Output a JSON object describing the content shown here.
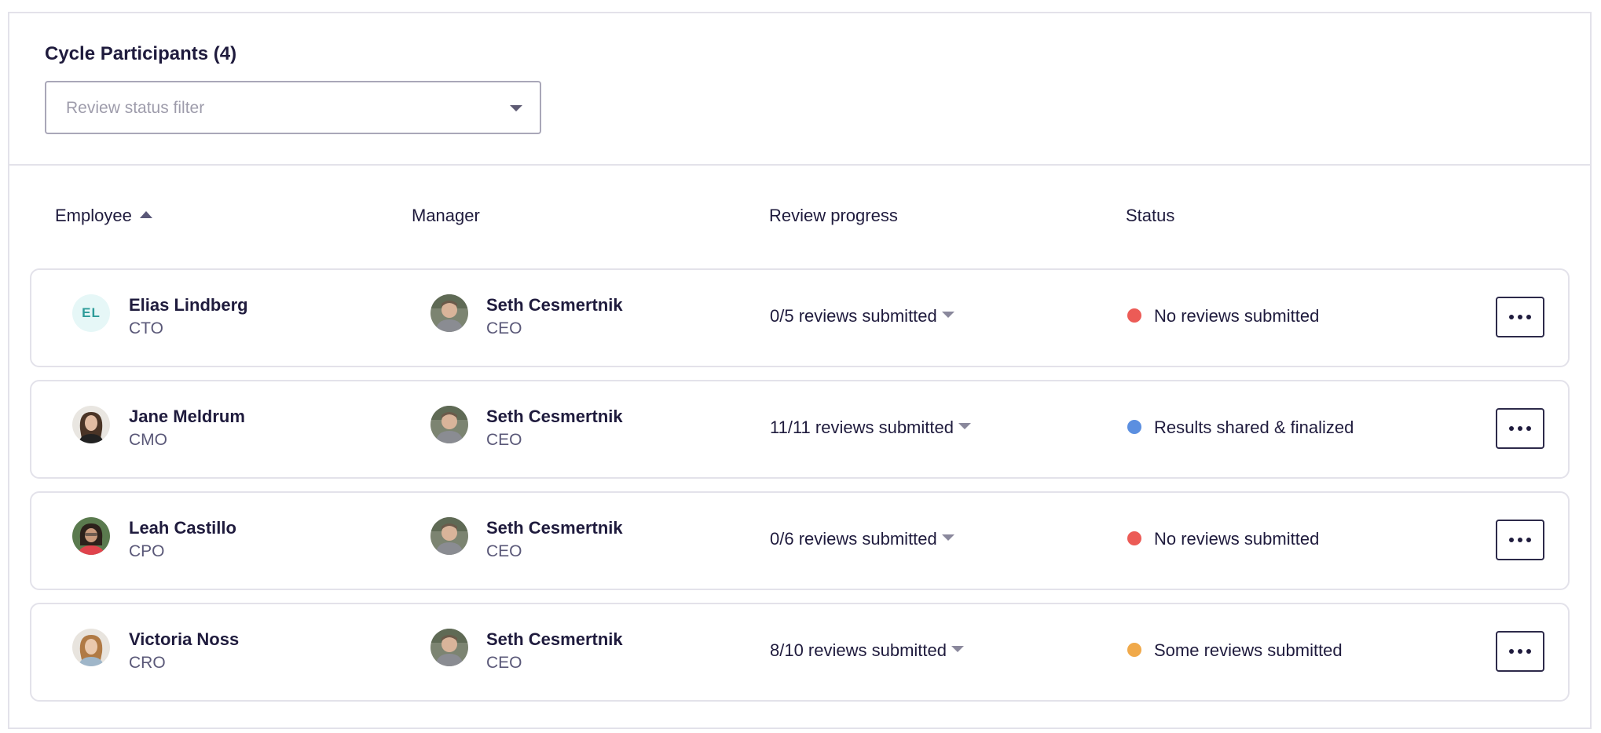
{
  "header": {
    "title": "Cycle Participants (4)",
    "filter_placeholder": "Review status filter"
  },
  "columns": {
    "employee": "Employee",
    "manager": "Manager",
    "progress": "Review progress",
    "status": "Status"
  },
  "rows": [
    {
      "employee_name": "Elias Lindberg",
      "employee_role": "CTO",
      "employee_initials": "EL",
      "manager_name": "Seth Cesmertnik",
      "manager_role": "CEO",
      "progress": "0/5 reviews submitted",
      "status": "No reviews submitted",
      "status_color": "#ec5b56"
    },
    {
      "employee_name": "Jane Meldrum",
      "employee_role": "CMO",
      "manager_name": "Seth Cesmertnik",
      "manager_role": "CEO",
      "progress": "11/11 reviews submitted",
      "status": "Results shared & finalized",
      "status_color": "#5b8fe0"
    },
    {
      "employee_name": "Leah Castillo",
      "employee_role": "CPO",
      "manager_name": "Seth Cesmertnik",
      "manager_role": "CEO",
      "progress": "0/6 reviews submitted",
      "status": "No reviews submitted",
      "status_color": "#ec5b56"
    },
    {
      "employee_name": "Victoria Noss",
      "employee_role": "CRO",
      "manager_name": "Seth Cesmertnik",
      "manager_role": "CEO",
      "progress": "8/10 reviews submitted",
      "status": "Some reviews submitted",
      "status_color": "#f0a94a"
    }
  ],
  "icons": {
    "sort": "sort-ascending-icon",
    "filter_caret": "chevron-down-icon",
    "more": "more-horizontal-icon"
  }
}
